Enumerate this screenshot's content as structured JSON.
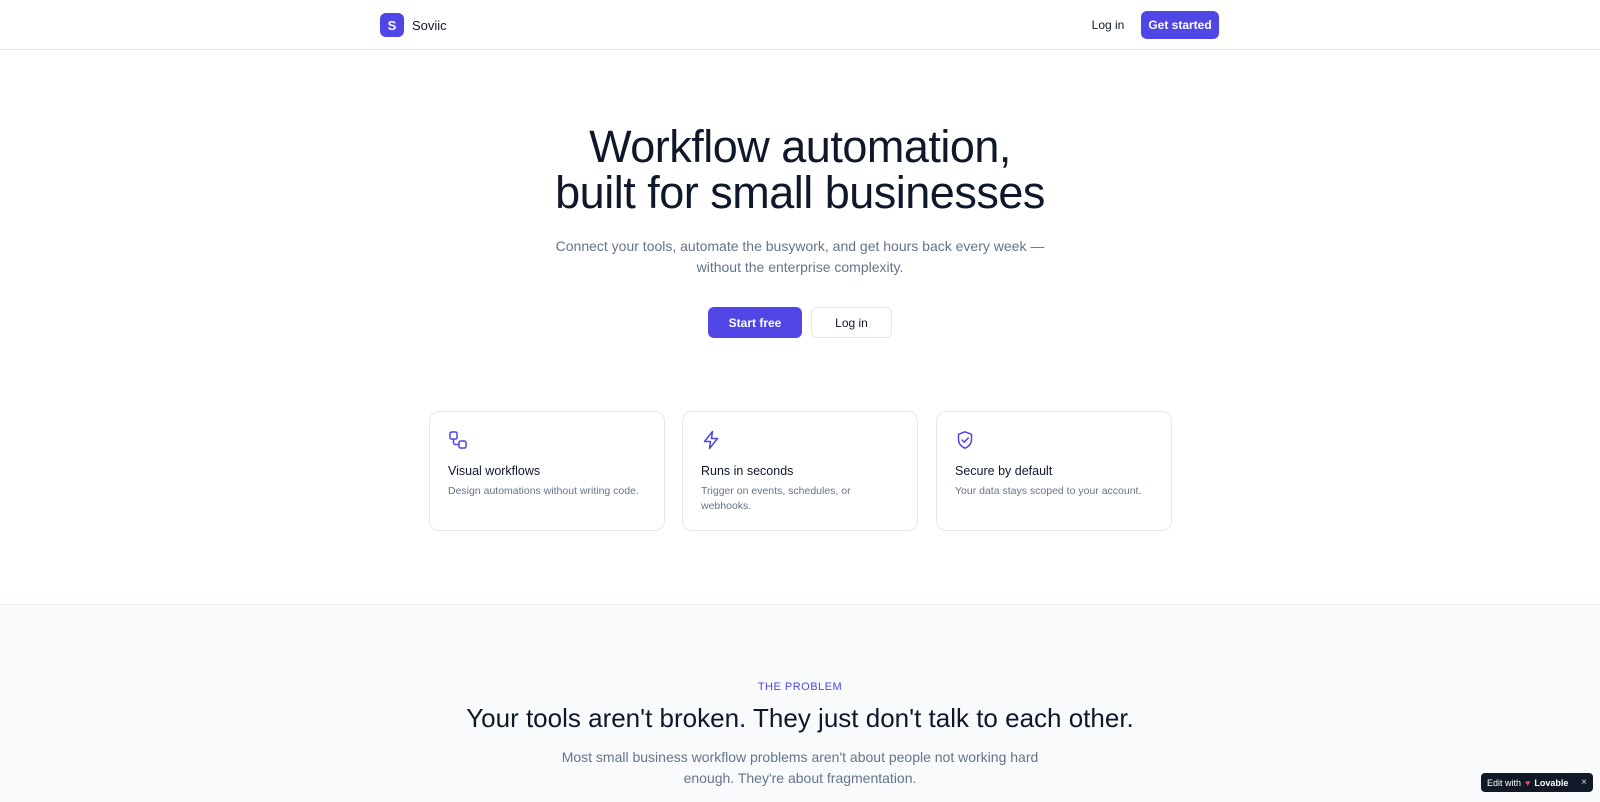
{
  "header": {
    "logo_letter": "S",
    "brand_name": "Soviic",
    "login_label": "Log in",
    "cta_label": "Get started"
  },
  "hero": {
    "title_line1": "Workflow automation,",
    "title_line2": "built for small businesses",
    "subtitle_line1": "Connect your tools, automate the busywork, and get hours back every week —",
    "subtitle_line2": "without the enterprise complexity.",
    "primary_button": "Start free",
    "secondary_button": "Log in"
  },
  "features": [
    {
      "icon": "workflow-icon",
      "title": "Visual workflows",
      "description": "Design automations without writing code."
    },
    {
      "icon": "lightning-icon",
      "title": "Runs in seconds",
      "description": "Trigger on events, schedules, or webhooks."
    },
    {
      "icon": "shield-check-icon",
      "title": "Secure by default",
      "description": "Your data stays scoped to your account."
    }
  ],
  "problem": {
    "eyebrow": "THE PROBLEM",
    "title": "Your tools aren't broken. They just don't talk to each other.",
    "subtitle_line1": "Most small business workflow problems aren't about people not working hard",
    "subtitle_line2": "enough. They're about fragmentation."
  },
  "badge": {
    "prefix": "Edit with",
    "brand": "Lovable",
    "close": "×"
  },
  "colors": {
    "accent": "#4f46e5",
    "text": "#0f172a",
    "muted": "#64748b",
    "border": "#e5e7eb"
  }
}
